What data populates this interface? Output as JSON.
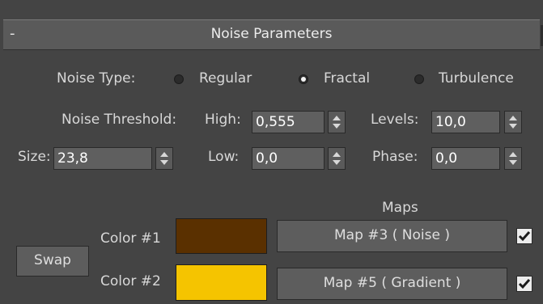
{
  "rollout": {
    "collapse_symbol": "-",
    "title": "Noise Parameters"
  },
  "noise_type": {
    "label": "Noise Type:",
    "options": [
      {
        "label": "Regular",
        "checked": false
      },
      {
        "label": "Fractal",
        "checked": true
      },
      {
        "label": "Turbulence",
        "checked": false
      }
    ]
  },
  "threshold": {
    "label": "Noise Threshold:",
    "high_label": "High:",
    "high_value": "0,555",
    "low_label": "Low:",
    "low_value": "0,0"
  },
  "levels": {
    "label": "Levels:",
    "value": "10,0"
  },
  "size": {
    "label": "Size:",
    "value": "23,8"
  },
  "phase": {
    "label": "Phase:",
    "value": "0,0"
  },
  "maps": {
    "header": "Maps",
    "swap_label": "Swap",
    "color1": {
      "label": "Color #1",
      "swatch": "#5a3000",
      "map_label": "Map #3  ( Noise )",
      "enabled": true
    },
    "color2": {
      "label": "Color #2",
      "swatch": "#f5c400",
      "map_label": "Map #5  ( Gradient )",
      "enabled": true
    }
  },
  "colors": {
    "panel_bg": "#444444",
    "header_bg": "#5a5a5a",
    "field_bg": "#5f5f5f",
    "text": "#d8d8d8"
  },
  "icons": {
    "spinner": "spinner-arrows-icon",
    "checkmark": "checkmark-icon"
  }
}
